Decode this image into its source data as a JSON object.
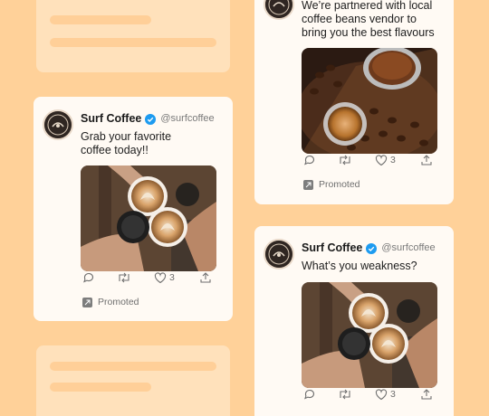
{
  "tweets": [
    {
      "display_name": "Surf Coffee",
      "handle": "@surfcoffee",
      "text": "Grab your favorite\ncoffee today!!",
      "like_count": "3",
      "promoted_label": "Promoted",
      "media": "latte-cheers-photo"
    },
    {
      "display_name": "",
      "handle": "",
      "text": "We’re partnered with local\ncoffee beans vendor to\nbring you the best flavours",
      "like_count": "3",
      "promoted_label": "Promoted",
      "media": "coffee-beans-grinder-photo"
    },
    {
      "display_name": "Surf Coffee",
      "handle": "@surfcoffee",
      "text": "What’s you weakness?",
      "like_count": "3",
      "promoted_label": "",
      "media": "latte-cheers-photo"
    }
  ],
  "icons": [
    "reply-icon",
    "retweet-icon",
    "like-icon",
    "share-icon",
    "verified-icon",
    "promoted-icon"
  ],
  "colors": {
    "background": "#ffd199",
    "placeholder_card": "#ffe1bb",
    "card": "#fffaf4",
    "verified": "#1d9bf0",
    "muted_text": "#6f6f6f"
  }
}
